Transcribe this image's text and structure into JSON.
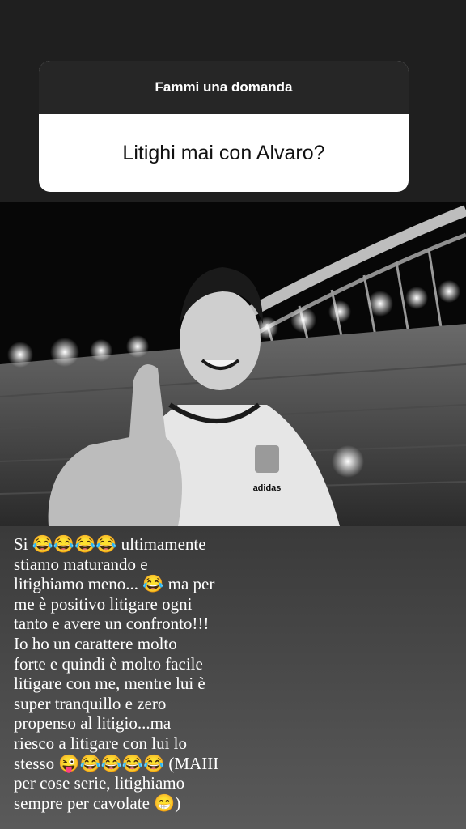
{
  "question_sticker": {
    "header": "Fammi una domanda",
    "question": "Litighi mai con Alvaro?"
  },
  "photo": {
    "jersey_brand": "adidas",
    "icon": "stadium-photo-icon"
  },
  "caption": {
    "lines": [
      "Si 😂😂😂😂 ultimamente",
      "stiamo maturando e",
      "litighiamo meno... 😂 ma per",
      "me è positivo litigare ogni",
      "tanto e avere un confronto!!!",
      "Io ho un carattere molto",
      "forte e quindi è molto facile",
      "litigare con me, mentre lui è",
      "super tranquillo e zero",
      "propenso al litigio...ma",
      "riesco a litigare con lui lo",
      "stesso 😜😂😂😂😂 (MAIII",
      "per cose serie, litighiamo",
      "sempre per cavolate 😁)"
    ]
  }
}
